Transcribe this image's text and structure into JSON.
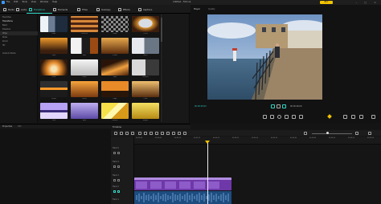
{
  "window": {
    "menu": [
      "File",
      "Edit",
      "Tools",
      "View",
      "Window",
      "Help"
    ],
    "title": "Untitled - Filmora",
    "buy_label": "BUY",
    "min_icon": "minimize-icon",
    "max_icon": "maximize-icon",
    "close_icon": "close-icon"
  },
  "toolbar": {
    "tabs": [
      {
        "label": "Media",
        "icon": "media-icon"
      },
      {
        "label": "Audio",
        "icon": "audio-icon"
      },
      {
        "label": "Transitions",
        "icon": "transitions-icon",
        "active": true
      },
      {
        "label": "Elements",
        "icon": "elements-icon"
      },
      {
        "label": "Titles",
        "icon": "titles-icon"
      },
      {
        "label": "Overlays",
        "icon": "overlays-icon"
      },
      {
        "label": "Effects",
        "icon": "effects-icon"
      },
      {
        "label": "Captions",
        "icon": "captions-icon"
      }
    ]
  },
  "sidebar": {
    "items": [
      {
        "label": "Favorites"
      },
      {
        "label": "Transitions",
        "selected": true
      },
      {
        "label": "Basic"
      },
      {
        "label": "Dissolve"
      },
      {
        "label": "Wipe"
      },
      {
        "label": "Slide"
      },
      {
        "label": "Zoom"
      },
      {
        "label": "3D"
      },
      {
        "label": "Custom Packs"
      }
    ]
  },
  "transitions": {
    "items": [
      {
        "label": "Fade"
      },
      {
        "label": "Dissolve"
      },
      {
        "label": "Wipe"
      },
      {
        "label": "Circle"
      },
      {
        "label": "Slide"
      },
      {
        "label": "Blur"
      },
      {
        "label": "Zoom"
      },
      {
        "label": "Burn"
      },
      {
        "label": "Glow"
      },
      {
        "label": "Flash"
      },
      {
        "label": "Spin"
      },
      {
        "label": "Shutter"
      },
      {
        "label": "Stripe"
      },
      {
        "label": "Glitch"
      },
      {
        "label": "Page"
      },
      {
        "label": "Cube"
      },
      {
        "label": "Fold"
      },
      {
        "label": "Split"
      },
      {
        "label": "Mosaic"
      },
      {
        "label": "Ripple"
      }
    ]
  },
  "player": {
    "label": "Player",
    "quality": "Quality",
    "time_current": "00:00:00:00",
    "time_total": "00:00:06:00"
  },
  "properties": {
    "label": "Properties",
    "sub": "Info"
  },
  "timeline": {
    "tab": "Timeline",
    "ruler": [
      "00:00:00",
      "00:00:05",
      "00:00:10",
      "00:00:15",
      "00:00:20",
      "00:00:25",
      "00:00:30",
      "00:00:35",
      "00:00:40",
      "00:00:45",
      "00:00:50",
      "00:00:55",
      "00:01:00"
    ],
    "tracks": [
      "Track 5",
      "Track 4",
      "Track 3",
      "Track 2",
      "Track 1"
    ],
    "accent": "#2fd6c6",
    "playhead_color": "#f3c400"
  }
}
